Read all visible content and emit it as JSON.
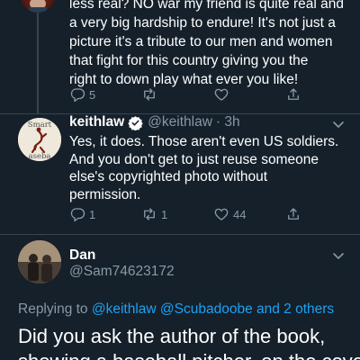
{
  "previous_tweet": {
    "text_lines": [
      "less real? NO war my friend is quite real and",
      "a very big hardship to endure! It's not just a",
      "picture it's a tribute to our men and women",
      "that fight for this country giving you the",
      "right to down play what ever you like!"
    ],
    "actions": {
      "replies": "5",
      "retweets": "",
      "likes": ""
    }
  },
  "reply_tweet": {
    "name": "keithlaw",
    "handle": "@keithlaw",
    "time": "· 3h",
    "verified": true,
    "avatar_text_top": "Smart",
    "avatar_text_bottom": "aseba",
    "text_lines": [
      "Yes, it does. Those aren't even US soldiers.",
      "And you don't get to just reuse someone",
      "else's copyrighted photo without",
      "permission."
    ],
    "actions": {
      "replies": "1",
      "retweets": "1",
      "likes": "44"
    }
  },
  "focus_tweet": {
    "name": "Dan",
    "handle": "@Sam74623172",
    "replying_to_prefix": "Replying to",
    "replying_to_users": "@keithlaw @Scubadoobe",
    "replying_to_others": "and 2 others",
    "text_line1": "Did you ask the author of the book,",
    "text_line2": "showing a baseball pitcher, on the cover"
  },
  "colors": {
    "background": "#15202b",
    "text": "#ffffff",
    "secondary": "#8899a6",
    "accent": "#1da1f2",
    "divider": "#38444d"
  }
}
